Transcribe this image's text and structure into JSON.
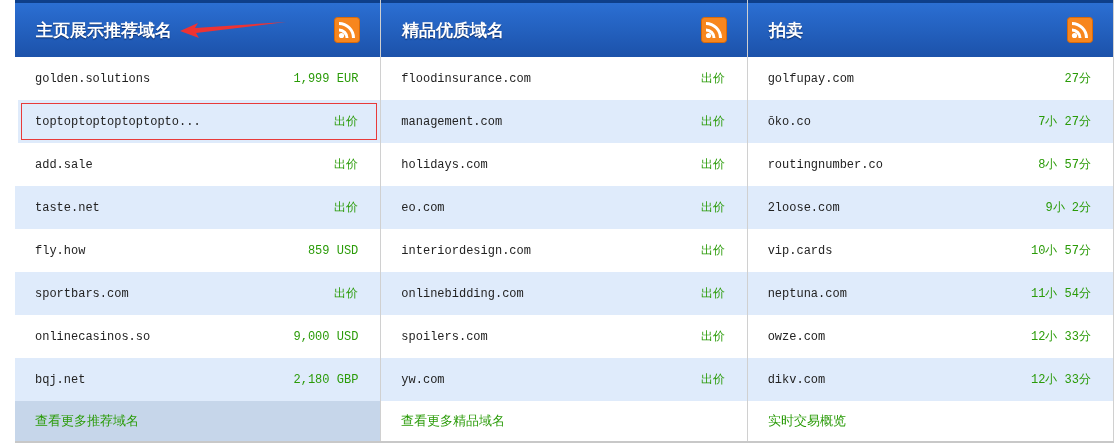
{
  "panels": [
    {
      "title": "主页展示推荐域名",
      "annotated": true,
      "rows": [
        {
          "domain": "golden.solutions",
          "value": "1,999 EUR",
          "highlighted": false
        },
        {
          "domain": "toptoptoptoptoptopto...",
          "value": "出价",
          "highlighted": true
        },
        {
          "domain": "add.sale",
          "value": "出价",
          "highlighted": false
        },
        {
          "domain": "taste.net",
          "value": "出价",
          "highlighted": false
        },
        {
          "domain": "fly.how",
          "value": "859 USD",
          "highlighted": false
        },
        {
          "domain": "sportbars.com",
          "value": "出价",
          "highlighted": false
        },
        {
          "domain": "onlinecasinos.so",
          "value": "9,000 USD",
          "highlighted": false
        },
        {
          "domain": "bqj.net",
          "value": "2,180 GBP",
          "highlighted": false
        }
      ],
      "footer": {
        "label": "查看更多推荐域名",
        "selected": true
      }
    },
    {
      "title": "精品优质域名",
      "annotated": false,
      "rows": [
        {
          "domain": "floodinsurance.com",
          "value": "出价",
          "highlighted": false
        },
        {
          "domain": "management.com",
          "value": "出价",
          "highlighted": false
        },
        {
          "domain": "holidays.com",
          "value": "出价",
          "highlighted": false
        },
        {
          "domain": "eo.com",
          "value": "出价",
          "highlighted": false
        },
        {
          "domain": "interiordesign.com",
          "value": "出价",
          "highlighted": false
        },
        {
          "domain": "onlinebidding.com",
          "value": "出价",
          "highlighted": false
        },
        {
          "domain": "spoilers.com",
          "value": "出价",
          "highlighted": false
        },
        {
          "domain": "yw.com",
          "value": "出价",
          "highlighted": false
        }
      ],
      "footer": {
        "label": "查看更多精品域名",
        "selected": false
      }
    },
    {
      "title": "拍卖",
      "annotated": false,
      "rows": [
        {
          "domain": "golfupay.com",
          "value": "27分",
          "highlighted": false
        },
        {
          "domain": "ōko.co",
          "value": "7小 27分",
          "highlighted": false
        },
        {
          "domain": "routingnumber.co",
          "value": "8小 57分",
          "highlighted": false
        },
        {
          "domain": "2loose.com",
          "value": "9小 2分",
          "highlighted": false
        },
        {
          "domain": "vip.cards",
          "value": "10小 57分",
          "highlighted": false
        },
        {
          "domain": "neptuna.com",
          "value": "11小 54分",
          "highlighted": false
        },
        {
          "domain": "owze.com",
          "value": "12小 33分",
          "highlighted": false
        },
        {
          "domain": "dikv.com",
          "value": "12小 33分",
          "highlighted": false
        }
      ],
      "footer": {
        "label": "实时交易概览",
        "selected": false
      }
    }
  ]
}
